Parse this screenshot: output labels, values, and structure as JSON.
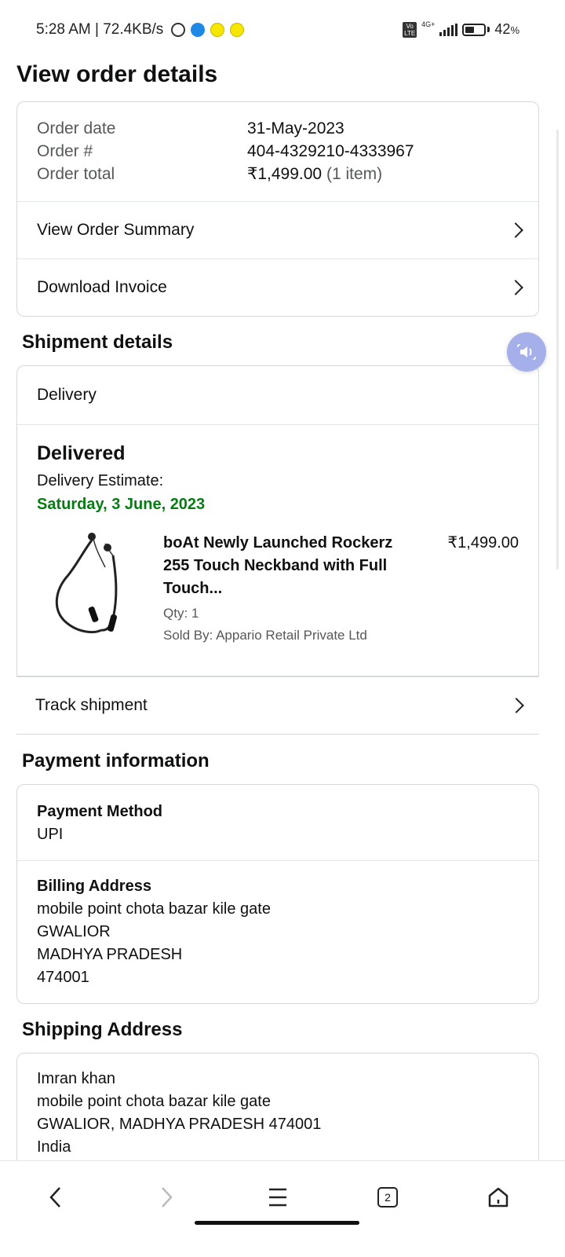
{
  "status_bar": {
    "time_speed": "5:28 AM | 72.4KB/s",
    "network_label": "4G+",
    "volte_label": "Vo LTE",
    "battery": "42",
    "battery_unit": "%"
  },
  "page": {
    "title": "View order details"
  },
  "order": {
    "date_label": "Order date",
    "date_value": "31-May-2023",
    "number_label": "Order #",
    "number_value": "404-4329210-4333967",
    "total_label": "Order total",
    "total_value": "₹1,499.00",
    "total_items": "(1 item)",
    "summary_link": "View Order Summary",
    "invoice_link": "Download Invoice"
  },
  "shipment": {
    "section_title": "Shipment details",
    "delivery_label": "Delivery",
    "status": "Delivered",
    "estimate_label": "Delivery Estimate:",
    "estimate_date": "Saturday, 3 June, 2023",
    "item": {
      "title": "boAt Newly Launched Rockerz 255 Touch Neckband with Full Touch...",
      "price": "₹1,499.00",
      "qty": "Qty: 1",
      "seller": "Sold By: Appario Retail Private Ltd"
    },
    "track_label": "Track shipment"
  },
  "payment": {
    "section_title": "Payment information",
    "method_label": "Payment Method",
    "method_value": "UPI",
    "billing_label": "Billing Address",
    "billing_lines": [
      "mobile point chota bazar kile gate",
      "GWALIOR",
      "MADHYA PRADESH",
      "474001"
    ]
  },
  "shipping": {
    "section_title": "Shipping Address",
    "lines": [
      "Imran khan",
      "mobile point chota bazar kile gate",
      "GWALIOR, MADHYA PRADESH 474001",
      "India"
    ]
  },
  "bottom_nav": {
    "tab_count": "2",
    "icons": [
      "back-icon",
      "forward-icon",
      "menu-icon",
      "tabs-icon",
      "home-icon"
    ]
  },
  "colors": {
    "delivery_green": "#067d12",
    "float_button": "#a5afe9",
    "border": "#d5d9d9"
  }
}
